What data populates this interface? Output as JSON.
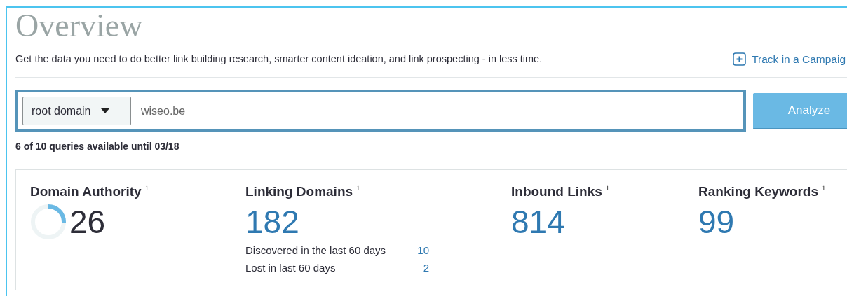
{
  "title": "Overview",
  "description": "Get the data you need to do better link building research, smarter content ideation, and link prospecting - in less time.",
  "track_link": "Track in a Campaig",
  "search": {
    "scope": "root domain",
    "value": "wiseo.be",
    "button": "Analyze"
  },
  "quota": "6 of 10 queries available until 03/18",
  "metrics": [
    {
      "kind": "donut",
      "label": "Domain Authority",
      "info": "i",
      "value": "26",
      "level": 0.26
    },
    {
      "kind": "plain",
      "label": "Linking Domains",
      "info": "i",
      "value": "182",
      "details": [
        {
          "label": "Discovered in the last 60 days",
          "value": "10"
        },
        {
          "label": "Lost in last 60 days",
          "value": "2"
        }
      ]
    },
    {
      "kind": "plain",
      "label": "Inbound Links",
      "info": "i",
      "value": "814"
    },
    {
      "kind": "plain",
      "label": "Ranking Keywords",
      "info": "i",
      "value": "99"
    }
  ]
}
